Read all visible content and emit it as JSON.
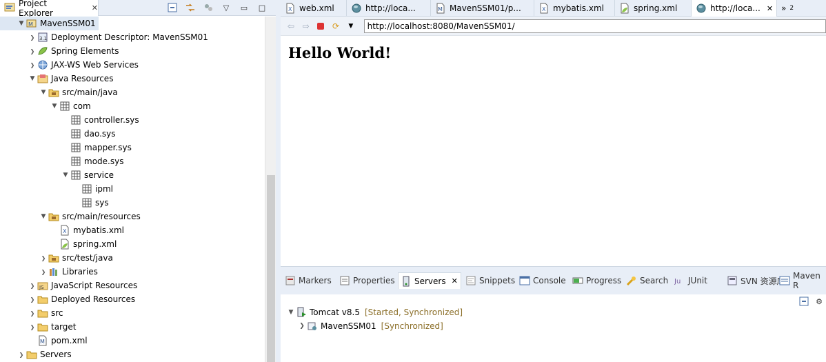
{
  "project_explorer": {
    "tab_label": "Project Explorer",
    "tree": [
      {
        "label": "MavenSSM01",
        "depth": 0,
        "expanded": true,
        "icon": "maven-project-icon",
        "selected": true
      },
      {
        "label": "Deployment Descriptor: MavenSSM01",
        "depth": 1,
        "expanded": false,
        "icon": "deployment-descriptor-icon"
      },
      {
        "label": "Spring Elements",
        "depth": 1,
        "expanded": false,
        "icon": "spring-leaf-icon"
      },
      {
        "label": "JAX-WS Web Services",
        "depth": 1,
        "expanded": false,
        "icon": "web-services-icon"
      },
      {
        "label": "Java Resources",
        "depth": 1,
        "expanded": true,
        "icon": "java-resources-icon"
      },
      {
        "label": "src/main/java",
        "depth": 2,
        "expanded": true,
        "icon": "source-folder-icon"
      },
      {
        "label": "com",
        "depth": 3,
        "expanded": true,
        "icon": "package-icon"
      },
      {
        "label": "controller.sys",
        "depth": 4,
        "expanded": null,
        "icon": "package-icon"
      },
      {
        "label": "dao.sys",
        "depth": 4,
        "expanded": null,
        "icon": "package-icon"
      },
      {
        "label": "mapper.sys",
        "depth": 4,
        "expanded": null,
        "icon": "package-icon"
      },
      {
        "label": "mode.sys",
        "depth": 4,
        "expanded": null,
        "icon": "package-icon"
      },
      {
        "label": "service",
        "depth": 4,
        "expanded": true,
        "icon": "package-icon"
      },
      {
        "label": "ipml",
        "depth": 5,
        "expanded": null,
        "icon": "package-icon"
      },
      {
        "label": "sys",
        "depth": 5,
        "expanded": null,
        "icon": "package-icon"
      },
      {
        "label": "src/main/resources",
        "depth": 2,
        "expanded": true,
        "icon": "source-folder-icon"
      },
      {
        "label": "mybatis.xml",
        "depth": 3,
        "expanded": null,
        "icon": "xml-file-icon"
      },
      {
        "label": "spring.xml",
        "depth": 3,
        "expanded": null,
        "icon": "spring-xml-icon"
      },
      {
        "label": "src/test/java",
        "depth": 2,
        "expanded": false,
        "icon": "source-folder-icon"
      },
      {
        "label": "Libraries",
        "depth": 2,
        "expanded": false,
        "icon": "libraries-icon"
      },
      {
        "label": "JavaScript Resources",
        "depth": 1,
        "expanded": false,
        "icon": "javascript-resources-icon"
      },
      {
        "label": "Deployed Resources",
        "depth": 1,
        "expanded": false,
        "icon": "folder-icon"
      },
      {
        "label": "src",
        "depth": 1,
        "expanded": false,
        "icon": "folder-icon"
      },
      {
        "label": "target",
        "depth": 1,
        "expanded": false,
        "icon": "folder-icon"
      },
      {
        "label": "pom.xml",
        "depth": 1,
        "expanded": null,
        "icon": "maven-pom-icon"
      },
      {
        "label": "Servers",
        "depth": 0,
        "expanded": false,
        "icon": "folder-icon"
      }
    ]
  },
  "editor": {
    "tabs": [
      {
        "label": "web.xml",
        "icon": "xml-file-icon",
        "active": false
      },
      {
        "label": "http://loca...",
        "icon": "globe-icon",
        "active": false
      },
      {
        "label": "MavenSSM01/p...",
        "icon": "maven-pom-icon",
        "active": false
      },
      {
        "label": "mybatis.xml",
        "icon": "xml-file-icon",
        "active": false
      },
      {
        "label": "spring.xml",
        "icon": "spring-xml-icon",
        "active": false
      },
      {
        "label": "http://loca...",
        "icon": "globe-icon",
        "active": true
      }
    ],
    "overflow_count": "2",
    "url": "http://localhost:8080/MavenSSM01/",
    "page_heading": "Hello World!"
  },
  "bottom_panel": {
    "tabs": [
      {
        "label": "Markers",
        "icon": "markers-icon",
        "active": false
      },
      {
        "label": "Properties",
        "icon": "properties-icon",
        "active": false
      },
      {
        "label": "Servers",
        "icon": "servers-icon",
        "active": true
      },
      {
        "label": "Snippets",
        "icon": "snippets-icon",
        "active": false
      },
      {
        "label": "Console",
        "icon": "console-icon",
        "active": false
      },
      {
        "label": "Progress",
        "icon": "progress-icon",
        "active": false
      },
      {
        "label": "Search",
        "icon": "search-icon",
        "active": false
      },
      {
        "label": "JUnit",
        "icon": "junit-icon",
        "active": false
      },
      {
        "label": "SVN 资源库",
        "icon": "svn-icon",
        "active": false
      },
      {
        "label": "Maven R",
        "icon": "maven-icon",
        "active": false
      }
    ],
    "servers": [
      {
        "name": "Tomcat v8.5",
        "state": "[Started, Synchronized]",
        "expanded": true,
        "depth": 0
      },
      {
        "name": "MavenSSM01",
        "state": "[Synchronized]",
        "expanded": false,
        "depth": 1
      }
    ]
  }
}
